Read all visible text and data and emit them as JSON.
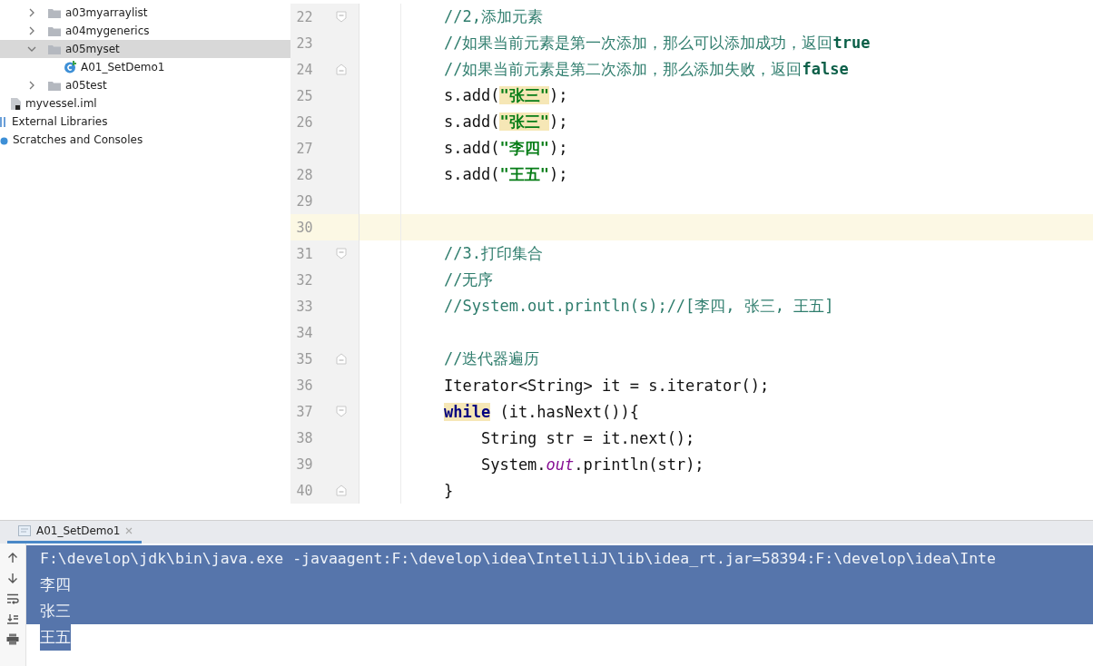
{
  "project_tree": [
    {
      "label": "a03myarraylist",
      "kind": "folder",
      "expanded": false,
      "selected": false
    },
    {
      "label": "a04mygenerics",
      "kind": "folder",
      "expanded": false,
      "selected": false
    },
    {
      "label": "a05myset",
      "kind": "folder",
      "expanded": true,
      "selected": true,
      "children": [
        {
          "label": "A01_SetDemo1",
          "kind": "class",
          "selected": false
        }
      ]
    },
    {
      "label": "a05test",
      "kind": "folder",
      "expanded": false,
      "selected": false
    },
    {
      "label": "myvessel.iml",
      "kind": "module-file",
      "selected": false
    },
    {
      "label": "External Libraries",
      "kind": "libraries",
      "selected": false
    },
    {
      "label": "Scratches and Consoles",
      "kind": "scratches",
      "selected": false
    }
  ],
  "editor": {
    "lines": [
      {
        "number": "22",
        "fold_start": true,
        "current": false,
        "segments": [
          {
            "text": "//2,添加元素",
            "kind": "comment",
            "highlighted": false
          }
        ]
      },
      {
        "number": "23",
        "current": false,
        "segments": [
          {
            "text": "//如果当前元素是第一次添加，那么可以添加成功，返回**true**",
            "kind": "comment",
            "highlighted": false
          }
        ]
      },
      {
        "number": "24",
        "fold_start": false,
        "current": false,
        "segments": [
          {
            "text": "//如果当前元素是第二次添加，那么添加失败，返回**false**",
            "kind": "comment",
            "highlighted": false
          }
        ]
      },
      {
        "number": "25",
        "current": false,
        "segments": [
          {
            "text": "s.add(",
            "kind": "plain",
            "highlighted": false
          },
          {
            "text": "\"张三\"",
            "kind": "string",
            "highlighted": true
          },
          {
            "text": ");",
            "kind": "plain",
            "highlighted": false
          }
        ]
      },
      {
        "number": "26",
        "current": false,
        "segments": [
          {
            "text": "s.add(",
            "kind": "plain",
            "highlighted": false
          },
          {
            "text": "\"张三\"",
            "kind": "string",
            "highlighted": true
          },
          {
            "text": ");",
            "kind": "plain",
            "highlighted": false
          }
        ]
      },
      {
        "number": "27",
        "current": false,
        "segments": [
          {
            "text": "s.add(",
            "kind": "plain",
            "highlighted": false
          },
          {
            "text": "\"李四\"",
            "kind": "string",
            "highlighted": false
          },
          {
            "text": ");",
            "kind": "plain",
            "highlighted": false
          }
        ]
      },
      {
        "number": "28",
        "current": false,
        "segments": [
          {
            "text": "s.add(",
            "kind": "plain",
            "highlighted": false
          },
          {
            "text": "\"王五\"",
            "kind": "string",
            "highlighted": false
          },
          {
            "text": ");",
            "kind": "plain",
            "highlighted": false
          }
        ]
      },
      {
        "number": "29",
        "current": false
      },
      {
        "number": "30",
        "current": true
      },
      {
        "number": "31",
        "fold_start": true,
        "current": false,
        "segments": [
          {
            "text": "//3.打印集合",
            "kind": "comment",
            "highlighted": false
          }
        ]
      },
      {
        "number": "32",
        "current": false,
        "segments": [
          {
            "text": "//无序",
            "kind": "comment",
            "highlighted": false
          }
        ]
      },
      {
        "number": "33",
        "current": false,
        "segments": [
          {
            "text": "//System.out.println(s);//[李四, 张三, 王五]",
            "kind": "comment",
            "highlighted": false
          }
        ]
      },
      {
        "number": "34",
        "current": false
      },
      {
        "number": "35",
        "fold_start": false,
        "current": false,
        "segments": [
          {
            "text": "//迭代器遍历",
            "kind": "comment",
            "highlighted": false
          }
        ]
      },
      {
        "number": "36",
        "current": false,
        "segments": [
          {
            "text": "Iterator<String> it = s.iterator();",
            "kind": "plain",
            "highlighted": false
          }
        ]
      },
      {
        "number": "37",
        "fold_start": true,
        "current": false,
        "segments": [
          {
            "text": "while",
            "kind": "keyword",
            "highlighted": true
          },
          {
            "text": " (it.hasNext()){",
            "kind": "plain",
            "highlighted": false
          }
        ]
      },
      {
        "number": "38",
        "current": false,
        "segments": [
          {
            "text": "    String str = it.next();",
            "kind": "plain",
            "highlighted": false
          }
        ]
      },
      {
        "number": "39",
        "current": false,
        "segments": [
          {
            "text": "    System.",
            "kind": "plain",
            "highlighted": false
          },
          {
            "text": "out",
            "kind": "field",
            "highlighted": false
          },
          {
            "text": ".println(str);",
            "kind": "plain",
            "highlighted": false
          }
        ]
      },
      {
        "number": "40",
        "fold_start": false,
        "current": false,
        "segments": [
          {
            "text": "}",
            "kind": "plain",
            "highlighted": false
          }
        ]
      }
    ]
  },
  "run_panel": {
    "tab": {
      "label": "A01_SetDemo1",
      "selected": true
    },
    "console_lines": [
      {
        "text": "F:\\develop\\jdk\\bin\\java.exe -javaagent:F:\\develop\\idea\\IntelliJ\\lib\\idea_rt.jar=58394:F:\\develop\\idea\\Inte",
        "selected": true,
        "whole_row": true
      },
      {
        "text": "李四",
        "selected": true,
        "whole_row": true
      },
      {
        "text": "张三",
        "selected": true,
        "whole_row": true
      },
      {
        "text": "王五",
        "selected": true,
        "whole_row": false
      }
    ]
  }
}
